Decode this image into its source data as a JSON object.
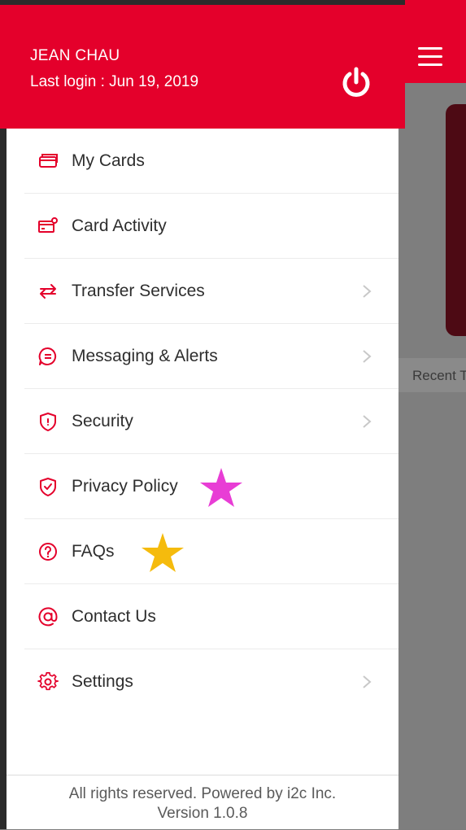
{
  "colors": {
    "accent": "#e4002b",
    "header_text": "#ffffff",
    "overlay": "#7e7e7e",
    "star_pink": "#e83dd5",
    "star_gold": "#f5bb0d"
  },
  "background": {
    "recent_label": "Recent T"
  },
  "drawer": {
    "user_name": "JEAN CHAU",
    "last_login": "Last login : Jun 19, 2019",
    "menu": [
      {
        "label": "My Cards",
        "icon": "cards-icon",
        "chevron": false
      },
      {
        "label": "Card Activity",
        "icon": "card-activity-icon",
        "chevron": false
      },
      {
        "label": "Transfer Services",
        "icon": "transfer-arrows-icon",
        "chevron": true
      },
      {
        "label": "Messaging & Alerts",
        "icon": "message-bubble-icon",
        "chevron": true
      },
      {
        "label": "Security",
        "icon": "shield-icon",
        "chevron": true
      },
      {
        "label": "Privacy Policy",
        "icon": "shield-check-icon",
        "chevron": false
      },
      {
        "label": "FAQs",
        "icon": "question-circle-icon",
        "chevron": false
      },
      {
        "label": "Contact Us",
        "icon": "at-sign-icon",
        "chevron": false
      },
      {
        "label": "Settings",
        "icon": "gear-icon",
        "chevron": true
      }
    ],
    "footer": {
      "line1": "All rights reserved. Powered by i2c Inc.",
      "line2": "Version 1.0.8"
    }
  }
}
